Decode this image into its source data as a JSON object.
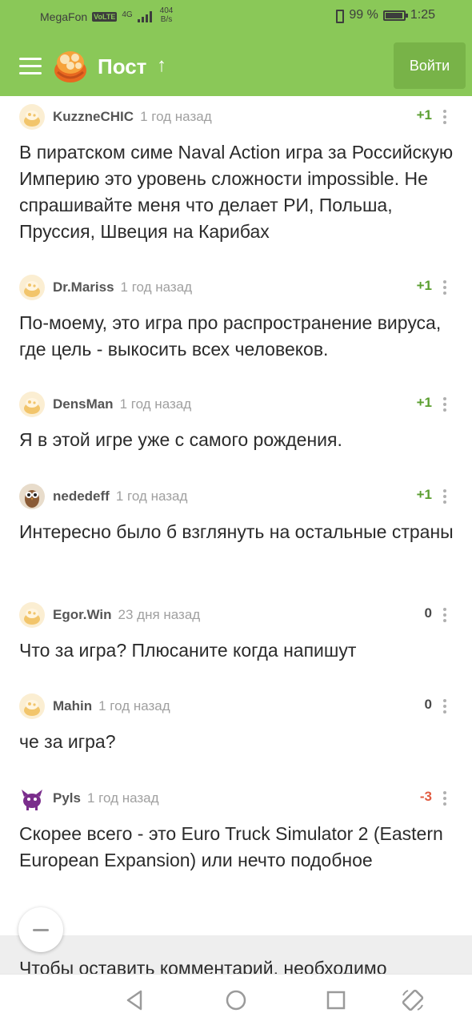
{
  "status_bar": {
    "carrier": "MegaFon",
    "volte": "VoLTE",
    "network": "4G",
    "speed_value": "404",
    "speed_unit": "B/s",
    "battery": "99 %",
    "time": "1:25"
  },
  "app_bar": {
    "menu_icon": "hamburger-icon",
    "logo_icon": "pikabu-cupcake-logo",
    "title": "Пост",
    "up_icon": "arrow-up-icon",
    "login_label": "Войти"
  },
  "colors": {
    "brand_green": "#8ac858",
    "login_button": "#78b348",
    "score_positive": "#5a9e2f",
    "score_negative": "#e15b41"
  },
  "comments": [
    {
      "author": "KuzzneCHIC",
      "time": "1 год назад",
      "score": "+1",
      "avatar": "default-avatar",
      "text": "В пиратском симе Naval Action игра за Российскую Империю это уровень сложности impossible. Не спрашивайте меня что делает РИ, Польша, Пруссия, Швеция на Карибах"
    },
    {
      "author": "Dr.Mariss",
      "time": "1 год назад",
      "score": "+1",
      "avatar": "default-avatar",
      "text": "По-моему, это игра про распространение вируса, где цель - выкосить всех человеков."
    },
    {
      "author": "DensMan",
      "time": "1 год назад",
      "score": "+1",
      "avatar": "default-avatar",
      "text": "Я в этой игре уже с самого рождения."
    },
    {
      "author": "nededeff",
      "time": "1 год назад",
      "score": "+1",
      "avatar": "owl-avatar",
      "text": "Интересно было б взглянуть на остальные страны"
    },
    {
      "author": "Egor.Win",
      "time": "23 дня назад",
      "score": "0",
      "avatar": "default-avatar",
      "text": "Что за игра? Плюсаните когда напишут"
    },
    {
      "author": "Mahin",
      "time": "1 год назад",
      "score": "0",
      "avatar": "default-avatar",
      "text": "че за игра?"
    },
    {
      "author": "Pyls",
      "time": "1 год назад",
      "score": "-3",
      "avatar": "purple-creature-avatar",
      "text": "Скорее всего - это Euro Truck Simulator 2 (Eastern European Expansion) или нечто подобное"
    }
  ],
  "bottom": {
    "collapse_icon": "minus-icon",
    "login_note": "Чтобы оставить комментарий, необходимо"
  },
  "nav_bar": {
    "back_icon": "back-triangle-icon",
    "home_icon": "home-circle-icon",
    "recents_icon": "recents-square-icon",
    "rotate_icon": "rotate-screen-icon"
  }
}
